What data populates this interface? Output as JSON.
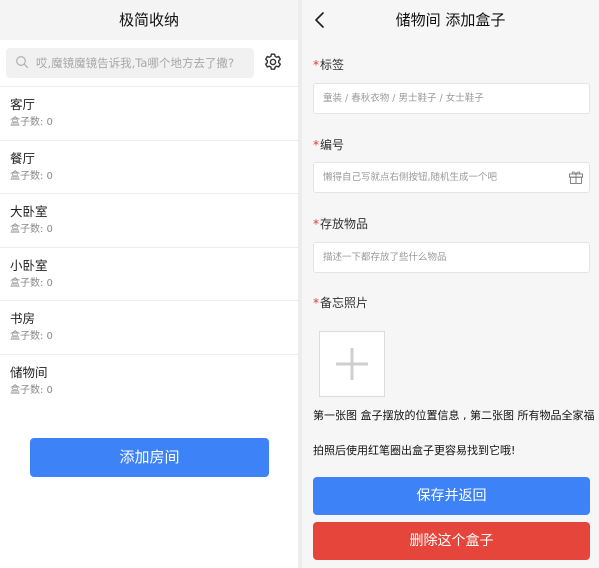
{
  "left": {
    "title": "极简收纳",
    "search": {
      "placeholder": "哎,魔镜魔镜告诉我,Ta哪个地方去了撒?",
      "value": ""
    },
    "rooms": [
      {
        "name": "客厅",
        "count_label": "盒子数: 0"
      },
      {
        "name": "餐厅",
        "count_label": "盒子数: 0"
      },
      {
        "name": "大卧室",
        "count_label": "盒子数: 0"
      },
      {
        "name": "小卧室",
        "count_label": "盒子数: 0"
      },
      {
        "name": "书房",
        "count_label": "盒子数: 0"
      },
      {
        "name": "储物间",
        "count_label": "盒子数: 0"
      }
    ],
    "add_room_label": "添加房间"
  },
  "right": {
    "title": "储物间 添加盒子",
    "tag": {
      "required_mark": "*",
      "label": "标签",
      "placeholder": "童装 / 春秋衣物 / 男士鞋子 / 女士鞋子",
      "value": ""
    },
    "number": {
      "required_mark": "*",
      "label": "编号",
      "placeholder": "懒得自己写就点右侧按钮,随机生成一个吧",
      "value": ""
    },
    "items": {
      "required_mark": "*",
      "label": "存放物品",
      "placeholder": "描述一下都存放了些什么物品",
      "value": ""
    },
    "photos": {
      "required_mark": "*",
      "label": "备忘照片"
    },
    "hint_line1": "第一张图 盒子摆放的位置信息 , 第二张图 所有物品全家福",
    "hint_line2": "拍照后使用红笔圈出盒子更容易找到它哦!",
    "save_label": "保存并返回",
    "delete_label": "删除这个盒子"
  },
  "colors": {
    "primary": "#3e82f7",
    "danger": "#e5453b",
    "required": "#e53935"
  },
  "icons": [
    "search-icon",
    "gear-icon",
    "back-icon",
    "gift-icon",
    "plus-icon"
  ]
}
